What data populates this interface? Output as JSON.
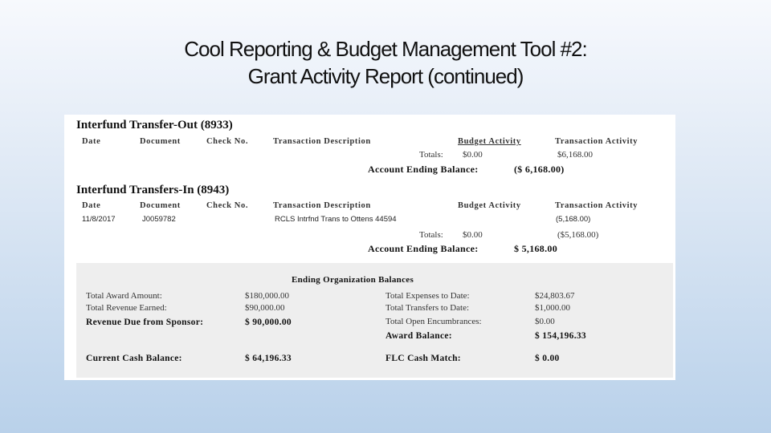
{
  "title_line1": "Cool Reporting & Budget Management Tool #2:",
  "title_line2": "Grant Activity Report (continued)",
  "transfer_out": {
    "heading": "Interfund Transfer-Out (8933)",
    "columns": [
      "Date",
      "Document",
      "Check No.",
      "Transaction Description",
      "Budget Activity",
      "Transaction Activity"
    ],
    "totals_label": "Totals:",
    "totals_budget": "$0.00",
    "totals_transaction": "$6,168.00",
    "ending_label": "Account Ending Balance:",
    "ending_value": "($ 6,168.00)"
  },
  "transfer_in": {
    "heading": "Interfund Transfers-In (8943)",
    "columns": [
      "Date",
      "Document",
      "Check No.",
      "Transaction Description",
      "Budget Activity",
      "Transaction Activity"
    ],
    "rows": [
      {
        "date": "11/8/2017",
        "document": "J0059782",
        "check": "",
        "description": "RCLS Intrfnd Trans to Ottens 44594",
        "budget": "",
        "transaction": "(5,168.00)"
      }
    ],
    "totals_label": "Totals:",
    "totals_budget": "$0.00",
    "totals_transaction": "($5,168.00)",
    "ending_label": "Account Ending Balance:",
    "ending_value": "$ 5,168.00"
  },
  "balances": {
    "heading": "Ending Organization Balances",
    "total_award_label": "Total Award Amount:",
    "total_award": "$180,000.00",
    "revenue_earned_label": "Total Revenue Earned:",
    "revenue_earned": "$90,000.00",
    "revenue_due_label": "Revenue Due from Sponsor:",
    "revenue_due": "$ 90,000.00",
    "expenses_label": "Total Expenses to Date:",
    "expenses": "$24,803.67",
    "transfers_label": "Total Transfers to Date:",
    "transfers": "$1,000.00",
    "encumbrances_label": "Total Open Encumbrances:",
    "encumbrances": "$0.00",
    "award_balance_label": "Award Balance:",
    "award_balance": "$ 154,196.33",
    "cash_balance_label": "Current Cash Balance:",
    "cash_balance": "$ 64,196.33",
    "cash_match_label": "FLC Cash Match:",
    "cash_match": "$ 0.00"
  }
}
